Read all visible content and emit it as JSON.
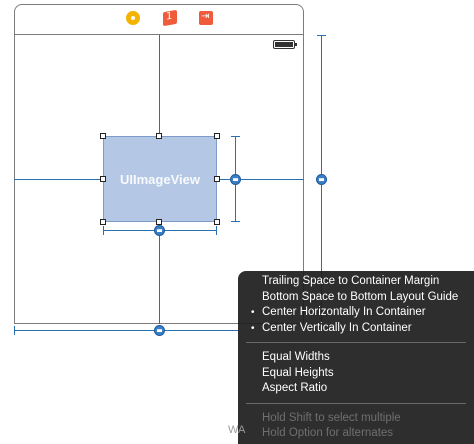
{
  "canvas": {
    "image_view_label": "UIImageView",
    "icons": {
      "view_controller": "view-controller-icon",
      "first_responder": "first-responder-cube-icon",
      "exit": "exit-icon",
      "battery": "battery-icon"
    },
    "colors": {
      "guide_blue": "#2a6fb0",
      "image_view_fill": "#b4c8e6",
      "dock_icon_yellow": "#f3b300",
      "dock_icon_red": "#f05b3c"
    }
  },
  "menu": {
    "group1": [
      {
        "label": "Trailing Space to Container Margin",
        "selected": false
      },
      {
        "label": "Bottom Space to Bottom Layout Guide",
        "selected": false
      },
      {
        "label": "Center Horizontally In Container",
        "selected": true
      },
      {
        "label": "Center Vertically In Container",
        "selected": true
      }
    ],
    "group2": [
      {
        "label": "Equal Widths"
      },
      {
        "label": "Equal Heights"
      },
      {
        "label": "Aspect Ratio"
      }
    ],
    "hints": [
      "Hold Shift to select multiple",
      "Hold Option for alternates"
    ],
    "bullet": "•"
  },
  "watermark": "WA"
}
